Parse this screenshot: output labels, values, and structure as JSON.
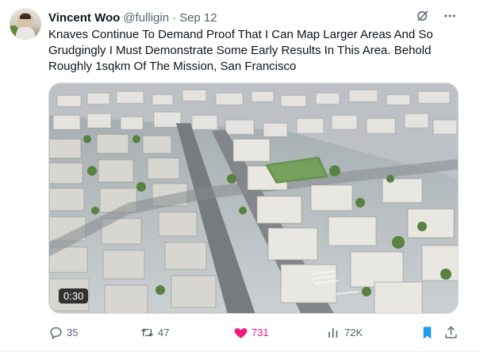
{
  "tweet": {
    "author_name": "Vincent Woo",
    "author_handle": "@fulligin",
    "separator": "·",
    "date": "Sep 12",
    "text": "Knaves Continue To Demand Proof That I Can Map Larger Areas And So Grudgingly I Must Demonstrate Some Early Results In This Area. Behold Roughly 1sqkm Of The Mission, San Francisco",
    "media": {
      "duration": "0:30"
    },
    "actions": {
      "replies": "35",
      "retweets": "47",
      "likes": "731",
      "views": "72K"
    }
  },
  "colors": {
    "like_active": "#f91880",
    "bookmark_active": "#1d9bf0",
    "muted": "#536471"
  },
  "icons": [
    "grok-icon",
    "more-icon",
    "reply-icon",
    "retweet-icon",
    "heart-icon",
    "views-icon",
    "bookmark-icon",
    "share-icon"
  ]
}
